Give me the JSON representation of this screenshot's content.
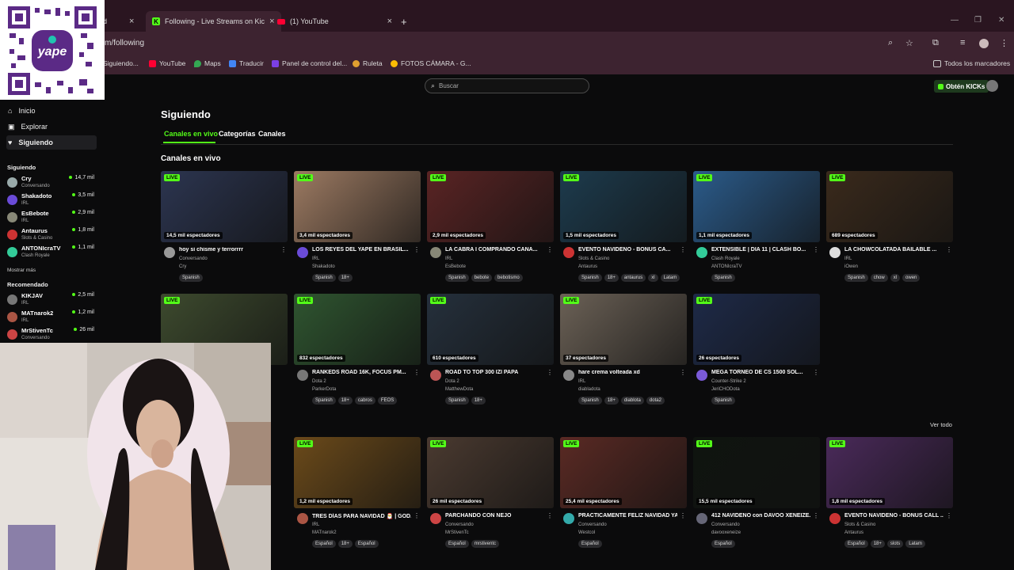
{
  "browser": {
    "tabs": [
      {
        "title": "d",
        "close": "×"
      },
      {
        "title": "Following - Live Streams on Kic",
        "close": "×"
      },
      {
        "title": "(1) YouTube",
        "close": "×"
      }
    ],
    "new_tab": "+",
    "url": "m/following",
    "bookmarks": [
      {
        "label": "Siguiendo...",
        "color": "#8a6d3b"
      },
      {
        "label": "YouTube",
        "color": "#ff0033"
      },
      {
        "label": "Maps",
        "color": "#34a853"
      },
      {
        "label": "Traducir",
        "color": "#4285f4"
      },
      {
        "label": "Panel de control del...",
        "color": "#7b3fe4"
      },
      {
        "label": "Ruleta",
        "color": "#e0a030"
      },
      {
        "label": "FOTOS CÁMARA - G...",
        "color": "#fbbc04"
      }
    ],
    "all_bookmarks": "Todos los marcadores"
  },
  "header": {
    "search_placeholder": "Buscar",
    "get_kicks": "Obtén KICKs"
  },
  "sidebar": {
    "nav": [
      {
        "label": "Inicio",
        "icon": "home-icon"
      },
      {
        "label": "Explorar",
        "icon": "compass-icon"
      },
      {
        "label": "Siguiendo",
        "icon": "heart-icon"
      }
    ],
    "following_title": "Siguiendo",
    "following": [
      {
        "name": "Cry",
        "category": "Conversando",
        "viewers": "14,7 mil",
        "color": "#9aa"
      },
      {
        "name": "Shakadoto",
        "category": "IRL",
        "viewers": "3,5 mil",
        "color": "#6a4bd8"
      },
      {
        "name": "EsBebote",
        "category": "IRL",
        "viewers": "2,9 mil",
        "color": "#887"
      },
      {
        "name": "Antaurus",
        "category": "Slots & Casino",
        "viewers": "1,8 mil",
        "color": "#c33"
      },
      {
        "name": "ANTONIcraTV",
        "category": "Clash Royale",
        "viewers": "1,1 mil",
        "color": "#3c9"
      }
    ],
    "show_more": "Mostrar más",
    "recommended_title": "Recomendado",
    "recommended": [
      {
        "name": "KIKJAV",
        "category": "IRL",
        "viewers": "2,5 mil",
        "color": "#777"
      },
      {
        "name": "MATnarok2",
        "category": "IRL",
        "viewers": "1,2 mil",
        "color": "#a54"
      },
      {
        "name": "MrStivenTc",
        "category": "Conversando",
        "viewers": "26 mil",
        "color": "#c44"
      }
    ]
  },
  "main": {
    "title": "Siguiendo",
    "tabs": [
      "Canales en vivo",
      "Categorías",
      "Canales"
    ],
    "section_title": "Canales en vivo",
    "see_all": "Ver todo",
    "live_label": "LIVE",
    "cards": [
      {
        "viewers": "14,5 mil espectadores",
        "title": "hoy si chisme y terrorrrr",
        "category": "Conversando",
        "channel": "Cry",
        "tags": [
          "Spanish"
        ],
        "thumb": "#2c3550",
        "av": "#999"
      },
      {
        "viewers": "3,4 mil espectadores",
        "title": "LOS REYES DEL YAPE EN BRASIL...",
        "category": "IRL",
        "channel": "Shakadoto",
        "tags": [
          "Spanish",
          "18+"
        ],
        "thumb": "#9c7a62",
        "av": "#6a4bd8"
      },
      {
        "viewers": "2,9 mil espectadores",
        "title": "LA CABRA I COMPRANDO CANA...",
        "category": "IRL",
        "channel": "EsBebote",
        "tags": [
          "Spanish",
          "bebote",
          "bebotismo"
        ],
        "thumb": "#5a2424",
        "av": "#887"
      },
      {
        "viewers": "1,5 mil espectadores",
        "title": "EVENTO NAVIDEÑO - BONUS CA...",
        "category": "Slots & Casino",
        "channel": "Antaurus",
        "tags": [
          "Spanish",
          "18+",
          "antaurus",
          "xl",
          "Latam"
        ],
        "thumb": "#1d3b4d",
        "av": "#c33"
      },
      {
        "viewers": "1,1 mil espectadores",
        "title": "EXTENSIBLE | DIA 11 | CLASH BO...",
        "category": "Clash Royale",
        "channel": "ANTONIcraTV",
        "tags": [
          "Spanish"
        ],
        "thumb": "#2b5b8a",
        "av": "#3c9"
      },
      {
        "viewers": "689 espectadores",
        "title": "LA CHOWCOLATADA BAILABLE ...",
        "category": "IRL",
        "channel": "iOwen",
        "tags": [
          "Spanish",
          "chow",
          "xl",
          "owen"
        ],
        "thumb": "#3a2a1c",
        "av": "#ddd"
      },
      {
        "viewers": "",
        "title": "",
        "category": "",
        "channel": "",
        "tags": [],
        "thumb": "#3d4a2e",
        "av": "#666"
      },
      {
        "viewers": "832 espectadores",
        "title": "RANKEDS ROAD 16K, FOCUS PM...",
        "category": "Dota 2",
        "channel": "ParkerDota",
        "tags": [
          "Spanish",
          "18+",
          "cabros",
          "FEOS"
        ],
        "thumb": "#2f5530",
        "av": "#777"
      },
      {
        "viewers": "610 espectadores",
        "title": "ROAD TO TOP 300 IZI PAPA",
        "category": "Dota 2",
        "channel": "MatthewDota",
        "tags": [
          "Spanish",
          "18+"
        ],
        "thumb": "#25303c",
        "av": "#b55"
      },
      {
        "viewers": "37 espectadores",
        "title": "hare crema volteada xd",
        "category": "IRL",
        "channel": "diabladota",
        "tags": [
          "Spanish",
          "18+",
          "diablota",
          "dota2"
        ],
        "thumb": "#6b6156",
        "av": "#888"
      },
      {
        "viewers": "26 espectadores",
        "title": "MEGA TORNEO DE CS 1500 SOL...",
        "category": "Counter-Strike 2",
        "channel": "JeriCHODota",
        "tags": [
          "Spanish"
        ],
        "thumb": "#1e2a48",
        "av": "#7a5ad8"
      },
      {
        "viewers": "1,2 mil espectadores",
        "title": "TRES DÍAS PARA NAVIDAD 🎅 | GOD...",
        "category": "IRL",
        "channel": "MATnarok2",
        "tags": [
          "Español",
          "18+",
          "Español"
        ],
        "thumb": "#6b4a1a",
        "av": "#a54"
      },
      {
        "viewers": "26 mil espectadores",
        "title": "PARCHANDO CON ÑEJO",
        "category": "Conversando",
        "channel": "MrStivenTc",
        "tags": [
          "Español",
          "mrstiventc"
        ],
        "thumb": "#4a3a30",
        "av": "#c44"
      },
      {
        "viewers": "25,4 mil espectadores",
        "title": "PRACTICAMENTE FELIZ NAVIDAD YA",
        "category": "Conversando",
        "channel": "Westcol",
        "tags": [
          "Español"
        ],
        "thumb": "#5a2a24",
        "av": "#3aa"
      },
      {
        "viewers": "15,5 mil espectadores",
        "title": "412 NAVIDEÑO con DAVOO XENEIZE...",
        "category": "Conversando",
        "channel": "davooxeneize",
        "tags": [
          "Español"
        ],
        "thumb": "#0f140f",
        "av": "#667"
      },
      {
        "viewers": "1,8 mil espectadores",
        "title": "EVENTO NAVIDEÑO - BONUS CALL ...",
        "category": "Slots & Casino",
        "channel": "Antaurus",
        "tags": [
          "Español",
          "18+",
          "slots",
          "Latam"
        ],
        "thumb": "#4a2a5a",
        "av": "#c33"
      }
    ]
  }
}
